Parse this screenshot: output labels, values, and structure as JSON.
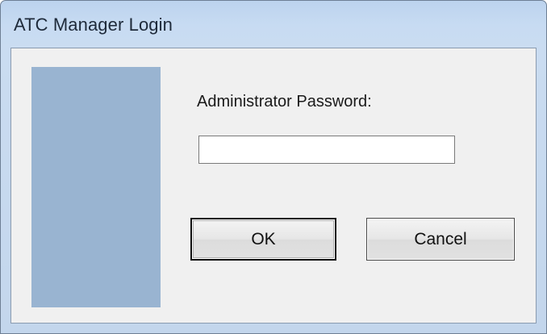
{
  "window": {
    "title": "ATC Manager Login"
  },
  "form": {
    "password_label": "Administrator Password:",
    "password_value": "",
    "password_placeholder": ""
  },
  "buttons": {
    "ok_label": "OK",
    "cancel_label": "Cancel"
  },
  "colors": {
    "side_panel": "#99b4d1",
    "client_background": "#f0f0f0",
    "titlebar": "#c7dbf2"
  }
}
